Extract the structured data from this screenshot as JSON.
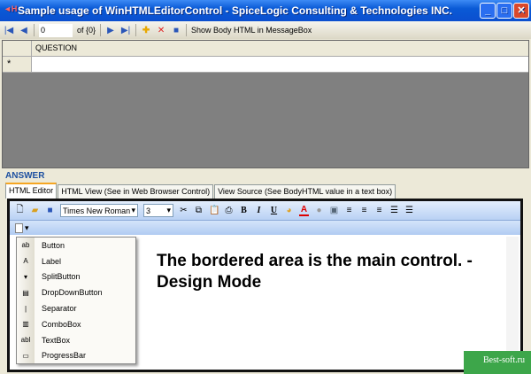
{
  "window": {
    "title": "Sample usage of WinHTMLEditorControl - SpiceLogic Consulting & Technologies INC."
  },
  "nav": {
    "position": "0",
    "of_label": "of {0}",
    "show_body_label": "Show Body HTML in MessageBox"
  },
  "grid": {
    "column": "QUESTION",
    "new_row_marker": "*"
  },
  "answer_label": "ANSWER",
  "tabs": [
    "HTML Editor",
    "HTML View (See in Web Browser Control)",
    "View Source (See BodyHTML value in a text box)"
  ],
  "editor": {
    "font": "Times New Roman",
    "size": "3",
    "content": "The bordered area is the main control. - Design Mode"
  },
  "menu": [
    {
      "label": "Button",
      "icon": "ab"
    },
    {
      "label": "Label",
      "icon": "A"
    },
    {
      "label": "SplitButton",
      "icon": "▾"
    },
    {
      "label": "DropDownButton",
      "icon": "▤"
    },
    {
      "label": "Separator",
      "icon": "|"
    },
    {
      "label": "ComboBox",
      "icon": "▥"
    },
    {
      "label": "TextBox",
      "icon": "abl"
    },
    {
      "label": "ProgressBar",
      "icon": "▭"
    }
  ],
  "watermark": "Best-soft.ru"
}
